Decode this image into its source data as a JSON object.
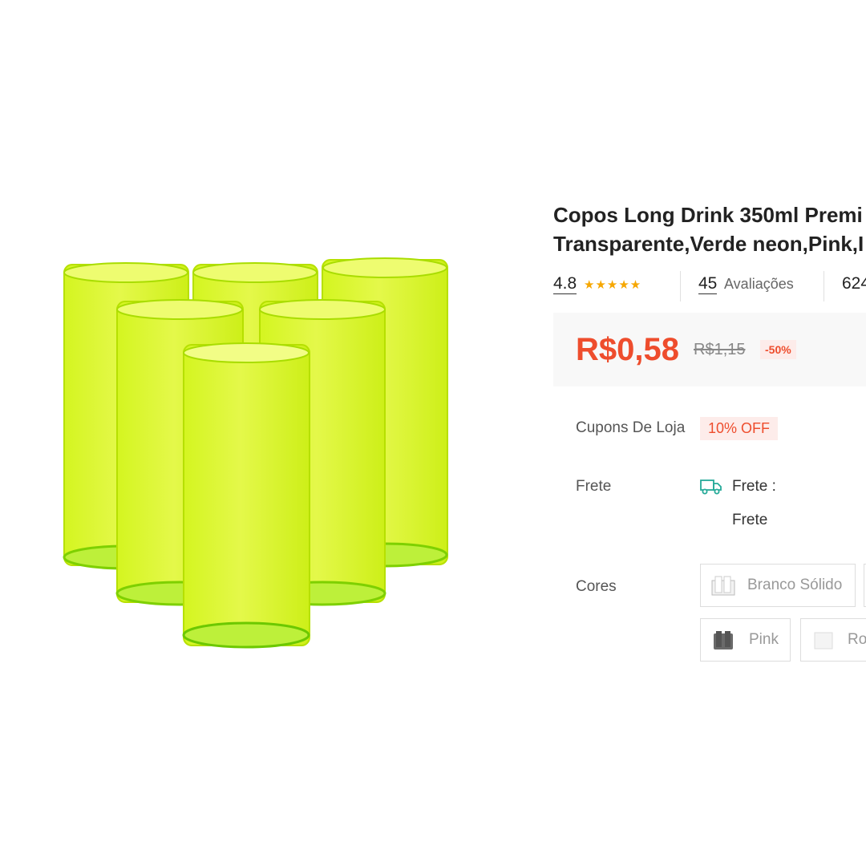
{
  "product": {
    "title_line1": "Copos Long Drink 350ml Premi",
    "title_line2": "Transparente,Verde neon,Pink,I",
    "rating": "4.8",
    "stars": "★★★★★",
    "reviews_count": "45",
    "reviews_label": "Avaliações",
    "sold_count": "624",
    "price_current": "R$0,58",
    "price_old": "R$1,15",
    "discount": "-50%"
  },
  "coupons": {
    "label": "Cupons De Loja",
    "value": "10% OFF"
  },
  "shipping": {
    "label": "Frete",
    "title": "Frete :",
    "value": "Frete"
  },
  "colors": {
    "label": "Cores",
    "options": [
      "Branco Sólido",
      "Pink",
      "Ro"
    ]
  },
  "accent_colors": {
    "price": "#ee4d2d",
    "star": "#f6a700",
    "glass": "#c6f200",
    "truck": "#26aa99"
  },
  "icons": {
    "shipping": "truck-icon",
    "rating": "star-icon"
  }
}
